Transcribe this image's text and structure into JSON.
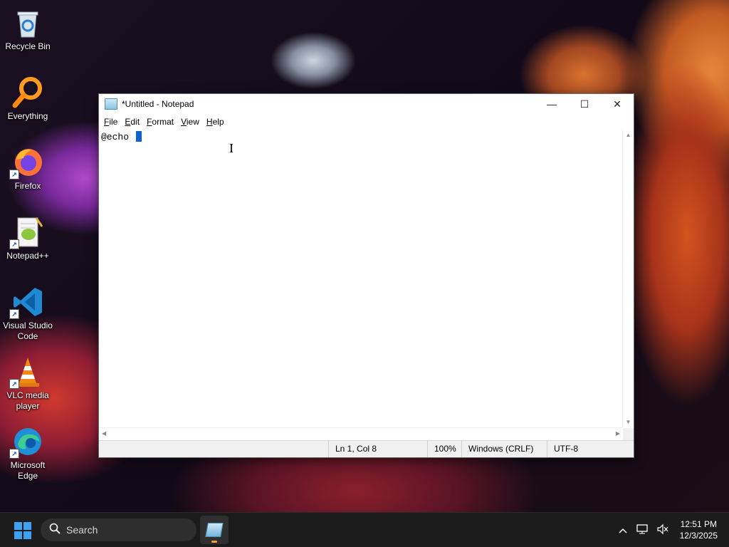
{
  "desktop": {
    "icons": [
      {
        "label": "Recycle Bin"
      },
      {
        "label": "Everything"
      },
      {
        "label": "Firefox"
      },
      {
        "label": "Notepad++"
      },
      {
        "label": "Visual Studio Code"
      },
      {
        "label": "VLC media player"
      },
      {
        "label": "Microsoft Edge"
      }
    ]
  },
  "window": {
    "title": "*Untitled - Notepad",
    "controls": {
      "minimize": "—",
      "maximize": "☐",
      "close": "✕"
    },
    "menu": [
      {
        "underline": "F",
        "rest": "ile"
      },
      {
        "underline": "E",
        "rest": "dit"
      },
      {
        "underline": "F",
        "rest": "ormat"
      },
      {
        "underline": "V",
        "rest": "iew"
      },
      {
        "underline": "H",
        "rest": "elp"
      }
    ],
    "editor_text": "@echo ",
    "status": {
      "position": "Ln 1, Col 8",
      "zoom": "100%",
      "line_ending": "Windows (CRLF)",
      "encoding": "UTF-8"
    }
  },
  "taskbar": {
    "search_placeholder": "Search",
    "time": "12:51 PM",
    "date": "12/3/2025"
  },
  "colors": {
    "caret": "#0b63d1",
    "taskbar": "#1c1c1c",
    "start": "#3fa2f0"
  }
}
